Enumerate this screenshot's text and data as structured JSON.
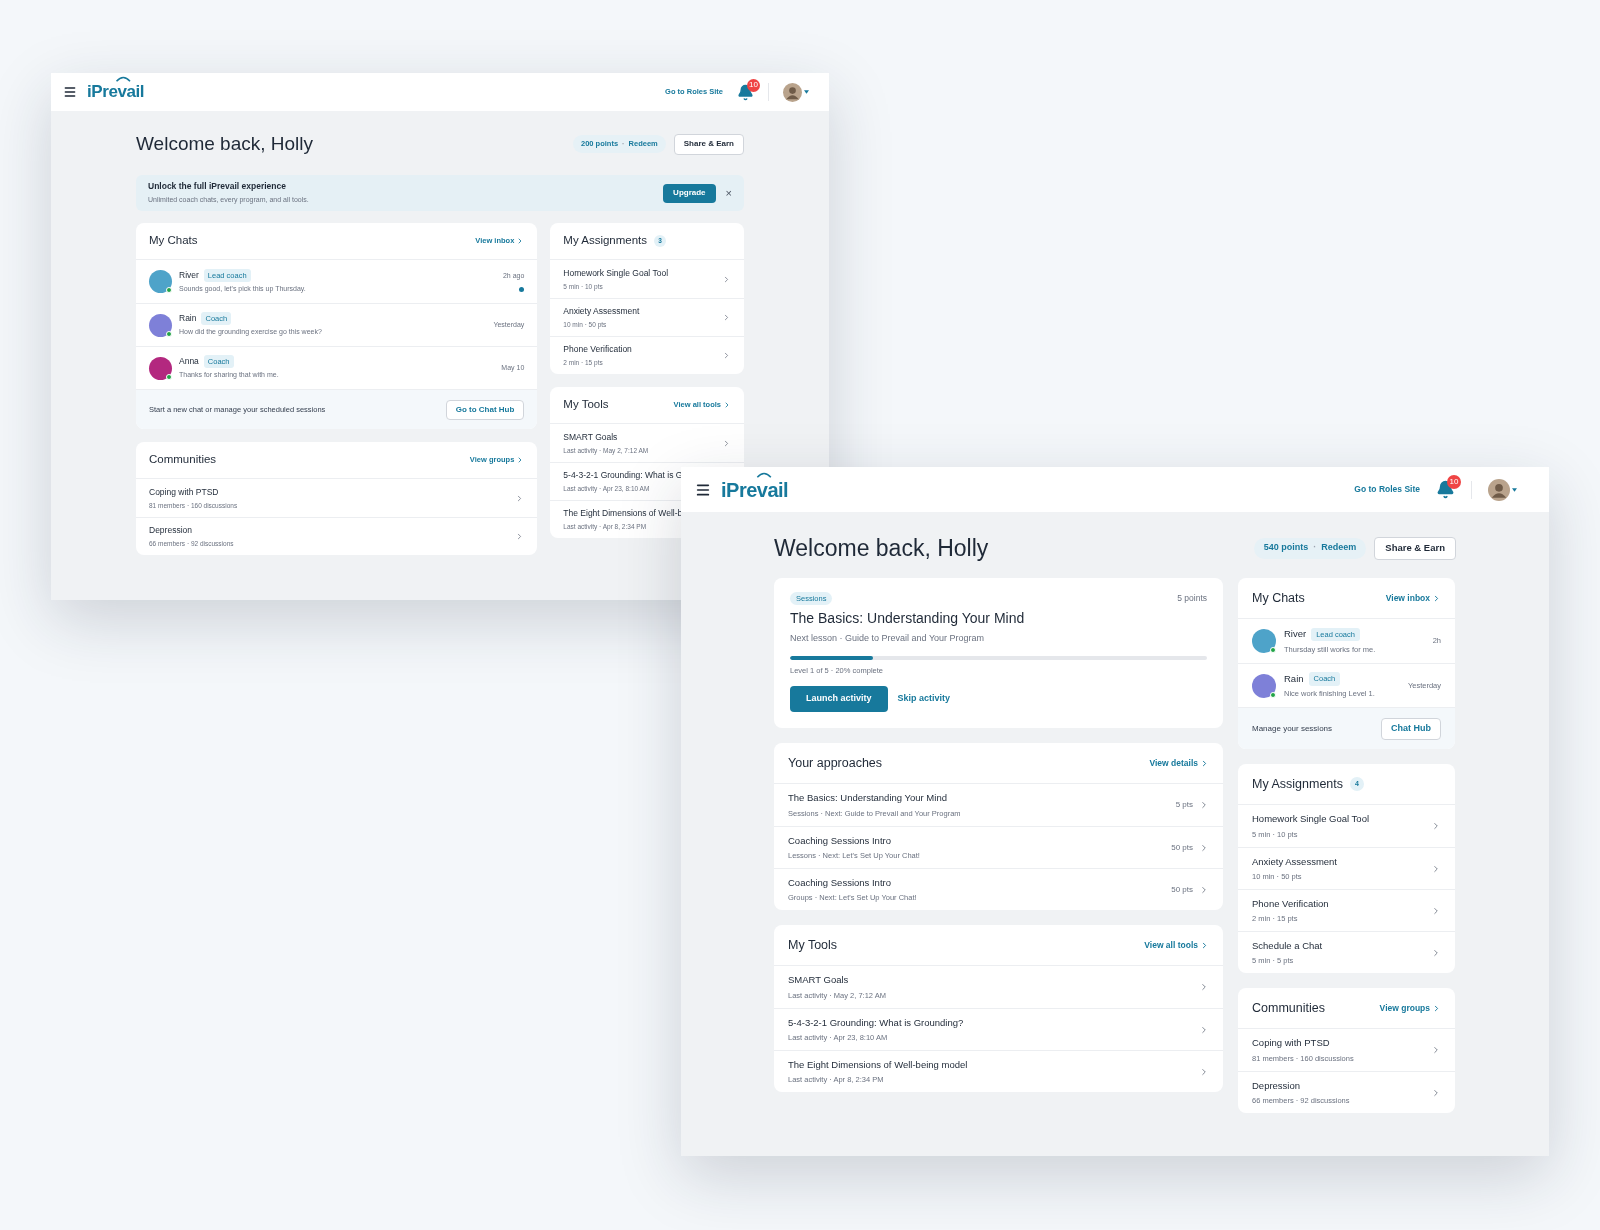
{
  "windows": [
    {
      "header": {
        "logo": "iPrevail",
        "link": "Go to Roles Site",
        "notifications": "10"
      },
      "welcome": "Welcome back, Holly",
      "points": "200 points",
      "separator": "·",
      "redeem": "Redeem",
      "share": "Share & Earn",
      "banner": {
        "title": "Unlock the full iPrevail experience",
        "text": "Unlimited coach chats, every program, and all tools.",
        "button": "Upgrade",
        "close": "×"
      },
      "main": [
        {
          "kind": "chats",
          "title": "My Chats",
          "link": "View inbox",
          "items": [
            {
              "name": "River",
              "role": "Lead coach",
              "message": "Sounds good, let's pick this up Thursday.",
              "time": "2h ago",
              "color": "#4ea3c9",
              "online": true,
              "unread": true
            },
            {
              "name": "Rain",
              "role": "Coach",
              "message": "How did the grounding exercise go this week?",
              "time": "Yesterday",
              "color": "#7e80d8",
              "online": true,
              "unread": false
            },
            {
              "name": "Anna",
              "role": "Coach",
              "message": "Thanks for sharing that with me.",
              "time": "May 10",
              "color": "#b3287f",
              "online": true,
              "unread": false
            }
          ],
          "footer": {
            "text": "Start a new chat or manage your scheduled sessions",
            "button": "Go to Chat Hub"
          }
        },
        {
          "kind": "list",
          "title": "Communities",
          "link": "View groups",
          "items": [
            {
              "title": "Coping with PTSD",
              "meta": "81 members · 160 discussions",
              "chevron": true
            },
            {
              "title": "Depression",
              "meta": "66 members · 92 discussions",
              "chevron": true
            }
          ]
        }
      ],
      "side": [
        {
          "kind": "list",
          "title": "My Assignments",
          "count": "3",
          "items": [
            {
              "title": "Homework Single Goal Tool",
              "meta": "5 min · 10 pts",
              "chevron": true
            },
            {
              "title": "Anxiety Assessment",
              "meta": "10 min · 50 pts",
              "chevron": true
            },
            {
              "title": "Phone Verification",
              "meta": "2 min · 15 pts",
              "chevron": true
            }
          ]
        },
        {
          "kind": "list",
          "title": "My Tools",
          "link": "View all tools",
          "items": [
            {
              "title": "SMART Goals",
              "meta": "Last activity · May 2, 7:12 AM",
              "chevron": true
            },
            {
              "title": "5-4-3-2-1 Grounding: What is G",
              "meta": "Last activity · Apr 23, 8:10 AM",
              "chevron": false
            },
            {
              "title": "The Eight Dimensions of Well-b",
              "meta": "Last activity · Apr 8, 2:34 PM",
              "chevron": false
            }
          ]
        }
      ]
    },
    {
      "header": {
        "logo": "iPrevail",
        "link": "Go to Roles Site",
        "notifications": "10"
      },
      "welcome": "Welcome back, Holly",
      "points": "540 points",
      "separator": "·",
      "redeem": "Redeem",
      "share": "Share & Earn",
      "main": [
        {
          "kind": "hero",
          "tag": "Sessions",
          "points": "5 points",
          "title": "The Basics: Understanding Your Mind",
          "next": "Next lesson · Guide to Prevail and Your Program",
          "level": 0.2,
          "progress": "Level 1 of 5 · 20% complete",
          "primary": "Launch activity",
          "secondary": "Skip activity"
        },
        {
          "kind": "list",
          "title": "Your approaches",
          "link": "View details",
          "items": [
            {
              "title": "The Basics: Understanding Your Mind",
              "meta": "Sessions · Next: Guide to Prevail and Your Program",
              "points": "5 pts",
              "chevron": true
            },
            {
              "title": "Coaching Sessions Intro",
              "meta": "Lessons · Next: Let's Set Up Your Chat!",
              "points": "50 pts",
              "chevron": true
            },
            {
              "title": "Coaching Sessions Intro",
              "meta": "Groups · Next: Let's Set Up Your Chat!",
              "points": "50 pts",
              "chevron": true
            }
          ]
        },
        {
          "kind": "list",
          "title": "My Tools",
          "link": "View all tools",
          "items": [
            {
              "title": "SMART Goals",
              "meta": "Last activity · May 2, 7:12 AM",
              "chevron": true
            },
            {
              "title": "5-4-3-2-1 Grounding: What is Grounding?",
              "meta": "Last activity · Apr 23, 8:10 AM",
              "chevron": true
            },
            {
              "title": "The Eight Dimensions of Well-being model",
              "meta": "Last activity · Apr 8, 2:34 PM",
              "chevron": true
            }
          ]
        }
      ],
      "side": [
        {
          "kind": "chats",
          "title": "My Chats",
          "link": "View inbox",
          "items": [
            {
              "name": "River",
              "role": "Lead coach",
              "message": "Thursday still works for me.",
              "time": "2h",
              "color": "#4ea3c9",
              "online": true,
              "unread": false
            },
            {
              "name": "Rain",
              "role": "Coach",
              "message": "Nice work finishing Level 1.",
              "time": "Yesterday",
              "color": "#7e80d8",
              "online": true,
              "unread": false
            }
          ],
          "footer": {
            "text": "Manage your sessions",
            "button": "Chat Hub"
          }
        },
        {
          "kind": "list",
          "title": "My Assignments",
          "count": "4",
          "items": [
            {
              "title": "Homework Single Goal Tool",
              "meta": "5 min · 10 pts",
              "chevron": true
            },
            {
              "title": "Anxiety Assessment",
              "meta": "10 min · 50 pts",
              "chevron": true
            },
            {
              "title": "Phone Verification",
              "meta": "2 min · 15 pts",
              "chevron": true
            },
            {
              "title": "Schedule a Chat",
              "meta": "5 min · 5 pts",
              "chevron": true
            }
          ]
        },
        {
          "kind": "list",
          "title": "Communities",
          "link": "View groups",
          "items": [
            {
              "title": "Coping with PTSD",
              "meta": "81 members · 160 discussions",
              "chevron": true
            },
            {
              "title": "Depression",
              "meta": "66 members · 92 discussions",
              "chevron": true
            }
          ]
        }
      ]
    }
  ]
}
